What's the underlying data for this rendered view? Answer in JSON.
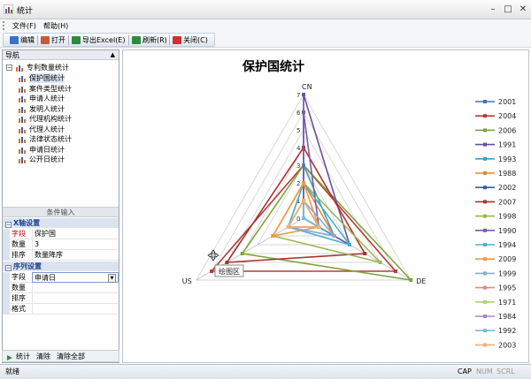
{
  "window": {
    "title": "统计"
  },
  "menu": {
    "items": [
      "文件(F)",
      "帮助(H)"
    ]
  },
  "toolbar": {
    "buttons": [
      {
        "label": "编辑",
        "icon": "edit-icon",
        "color": "#3a72c4"
      },
      {
        "label": "打开",
        "icon": "open-icon",
        "color": "#c85a3c"
      },
      {
        "label": "导出Excel(E)",
        "icon": "excel-icon",
        "color": "#2e8b3e"
      },
      {
        "label": "刷新(R)",
        "icon": "refresh-icon",
        "color": "#2e8b3e"
      },
      {
        "label": "关闭(C)",
        "icon": "close-icon",
        "color": "#d03030"
      }
    ]
  },
  "nav": {
    "title": "导航",
    "root": "专利数量统计",
    "items": [
      "保护国统计",
      "案件类型统计",
      "申请人统计",
      "发明人统计",
      "代理机构统计",
      "代理人统计",
      "法律状态统计",
      "申请日统计",
      "公开日统计"
    ],
    "selected_index": 0
  },
  "conditions": {
    "title": "条件输入",
    "x_group": {
      "title": "X轴设置",
      "rows": [
        {
          "key": "字段",
          "value": "保护国"
        },
        {
          "key": "数量",
          "value": "3"
        },
        {
          "key": "排序",
          "value": "数量降序"
        }
      ]
    },
    "series_group": {
      "title": "序列设置",
      "rows": [
        {
          "key": "字段",
          "value": "申请日"
        },
        {
          "key": "数量",
          "value": ""
        },
        {
          "key": "排序",
          "value": ""
        },
        {
          "key": "格式",
          "value": ""
        }
      ]
    }
  },
  "bottom": {
    "stat": "统计",
    "clear": "清除",
    "clear_all": "清除全部"
  },
  "status": {
    "ready": "就绪",
    "cap": "CAP",
    "num": "NUM",
    "scrl": "SCRL"
  },
  "tooltip": "绘图区",
  "chart_data": {
    "type": "radar",
    "title": "保护国统计",
    "categories": [
      "CN",
      "DE",
      "US"
    ],
    "rmax": 7,
    "ticks": [
      0,
      1,
      2,
      3,
      4,
      5,
      6,
      7
    ],
    "series": [
      {
        "name": "2001",
        "color": "#4a6fb5",
        "values": [
          1,
          1,
          1
        ]
      },
      {
        "name": "2004",
        "color": "#b83a3a",
        "values": [
          3,
          6,
          6
        ]
      },
      {
        "name": "2006",
        "color": "#7fa53a",
        "values": [
          3,
          7,
          4
        ]
      },
      {
        "name": "1991",
        "color": "#6b4fa0",
        "values": [
          7,
          3,
          0
        ]
      },
      {
        "name": "1993",
        "color": "#3a9fc0",
        "values": [
          3,
          2,
          0
        ]
      },
      {
        "name": "1988",
        "color": "#e08a2e",
        "values": [
          2,
          2,
          1
        ]
      },
      {
        "name": "2002",
        "color": "#3a5e9a",
        "values": [
          1,
          1,
          0
        ]
      },
      {
        "name": "2007",
        "color": "#a83232",
        "values": [
          4,
          4,
          5
        ]
      },
      {
        "name": "1998",
        "color": "#9ab850",
        "values": [
          2,
          5,
          2
        ]
      },
      {
        "name": "1990",
        "color": "#7a5aaa",
        "values": [
          6,
          1,
          0
        ]
      },
      {
        "name": "1994",
        "color": "#4ab0cc",
        "values": [
          2,
          3,
          1
        ]
      },
      {
        "name": "2009",
        "color": "#f09a40",
        "values": [
          2,
          1,
          2
        ]
      },
      {
        "name": "1999",
        "color": "#8aa8d8",
        "values": [
          1,
          2,
          1
        ]
      },
      {
        "name": "1995",
        "color": "#e08888",
        "values": [
          1,
          1,
          1
        ]
      },
      {
        "name": "1971",
        "color": "#b0d070",
        "values": [
          1,
          1,
          0
        ]
      },
      {
        "name": "1984",
        "color": "#a08ac8",
        "values": [
          1,
          1,
          0
        ]
      },
      {
        "name": "1992",
        "color": "#70c0d8",
        "values": [
          1,
          1,
          0
        ]
      },
      {
        "name": "2003",
        "color": "#f4b070",
        "values": [
          1,
          1,
          1
        ]
      }
    ]
  }
}
